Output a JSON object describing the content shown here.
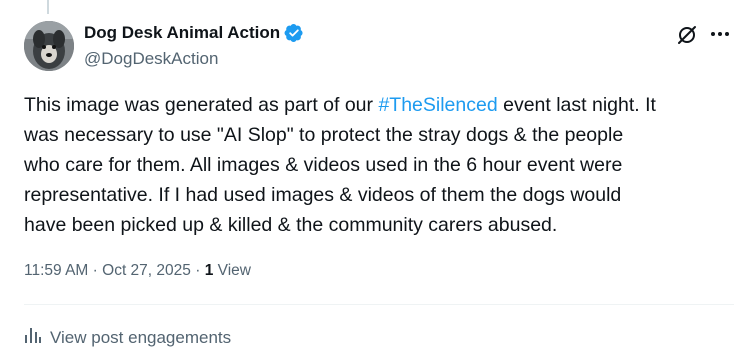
{
  "author": {
    "display_name": "Dog Desk Animal Action",
    "handle": "@DogDeskAction",
    "verified": true
  },
  "post": {
    "lines": [
      {
        "before": "This image was generated as part of our ",
        "hashtag": "#TheSilenced",
        "after": " event last night. It"
      },
      {
        "text": "was necessary to use \"AI Slop\" to protect the stray dogs & the people"
      },
      {
        "text": "who care for them. All images & videos used in the 6 hour event were"
      },
      {
        "text": "representative. If I had used images & videos of them the dogs would"
      },
      {
        "text": "have been picked up & killed & the community carers abused."
      }
    ]
  },
  "meta": {
    "time": "11:59 AM",
    "separator": "·",
    "date": "Oct 27, 2025",
    "views_count": "1",
    "views_label": "View"
  },
  "engagements": {
    "label": "View post engagements"
  },
  "icons": {
    "verified": "verified-badge-icon",
    "grok": "grok-icon",
    "more": "more-icon",
    "analytics": "analytics-icon"
  },
  "colors": {
    "accent": "#1d9bf0",
    "text": "#0f1419",
    "secondary": "#536471",
    "divider": "#eff3f4"
  }
}
